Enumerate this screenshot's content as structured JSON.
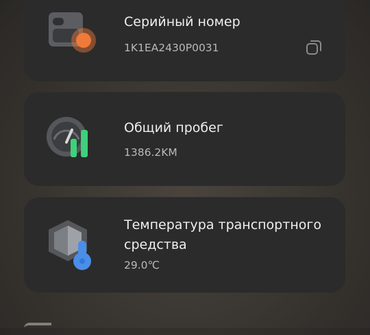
{
  "cards": [
    {
      "title": "Серийный номер",
      "value": "1K1EA2430P0031",
      "icon": "device-icon",
      "action_icon": "copy-icon"
    },
    {
      "title": "Общий пробег",
      "value": "1386.2KM",
      "icon": "odometer-icon"
    },
    {
      "title": "Температура транспортного средства",
      "value": "29.0℃",
      "icon": "temperature-icon"
    }
  ],
  "colors": {
    "card_bg": "#2b2b2b",
    "accent_orange": "#f07a3a",
    "accent_green": "#3fd07a",
    "accent_blue": "#4a8ee8"
  }
}
